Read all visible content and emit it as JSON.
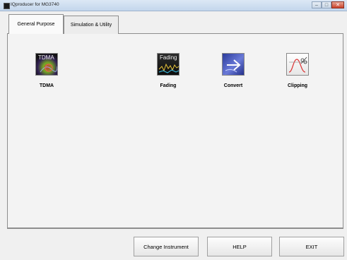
{
  "window": {
    "title": "IQproducer for MG3740",
    "minimize_symbol": "–",
    "maximize_symbol": "□",
    "close_symbol": "✕"
  },
  "tabs": [
    {
      "label": "General Purpose",
      "selected": true
    },
    {
      "label": "Simulation & Utility",
      "selected": false
    }
  ],
  "tools": [
    {
      "label": "TDMA",
      "icon": "tdma-icon",
      "icon_text": "TDMA"
    },
    {
      "label": "Fading",
      "icon": "fading-icon",
      "icon_text": "Fading"
    },
    {
      "label": "Convert",
      "icon": "convert-icon",
      "icon_text": ""
    },
    {
      "label": "Clipping",
      "icon": "clipping-icon",
      "icon_text": ""
    }
  ],
  "buttons": {
    "change_instrument": "Change Instrument",
    "help": "HELP",
    "exit": "EXIT"
  },
  "colors": {
    "background": "#f0f0f0",
    "titlebar": "#c3d6ec",
    "close_button": "#c9422a"
  }
}
